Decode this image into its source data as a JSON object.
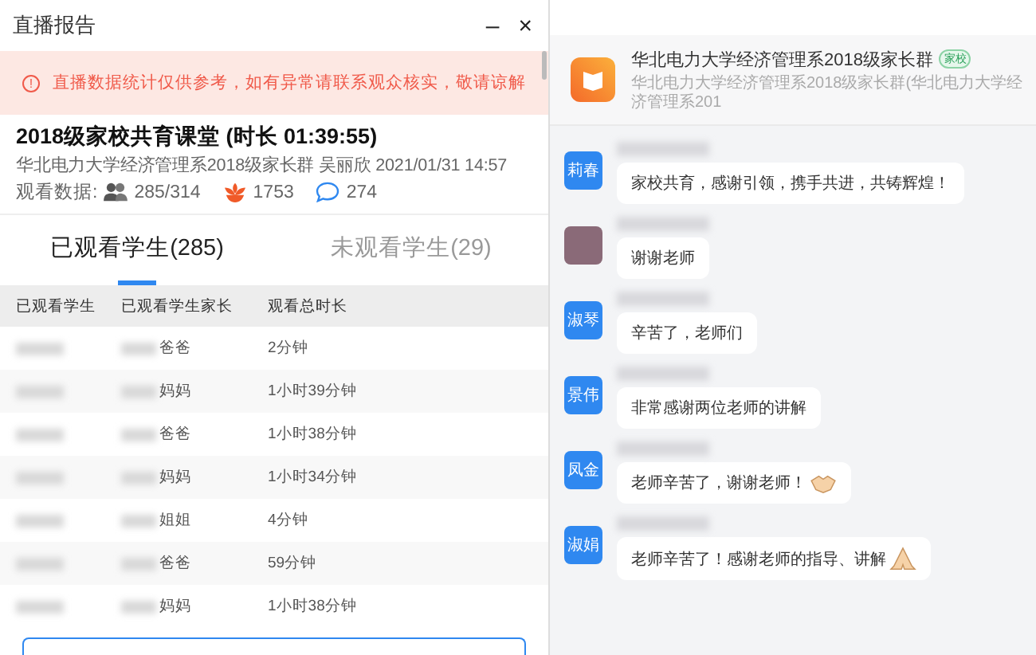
{
  "window": {
    "title": "直播报告",
    "controls": [
      "–",
      "×"
    ]
  },
  "notice": {
    "icon": "!",
    "text": "直播数据统计仅供参考，如有异常请联系观众核实，敬请谅解"
  },
  "report": {
    "title": "2018级家校共育课堂 (时长 01:39:55)",
    "meta": "华北电力大学经济管理系2018级家长群 吴丽欣 2021/01/31 14:57",
    "stats_label": "观看数据:",
    "viewers": "285/314",
    "likes": "1753",
    "comments": "274"
  },
  "tabs": [
    {
      "label": "已观看学生(285)",
      "selected": true
    },
    {
      "label": "未观看学生(29)",
      "selected": false
    }
  ],
  "table": {
    "columns": [
      "已观看学生",
      "已观看学生家长",
      "观看总时长"
    ],
    "rows": [
      {
        "parent": "爸爸",
        "duration": "2分钟"
      },
      {
        "parent": "妈妈",
        "duration": "1小时39分钟"
      },
      {
        "parent": "爸爸",
        "duration": "1小时38分钟"
      },
      {
        "parent": "妈妈",
        "duration": "1小时34分钟"
      },
      {
        "parent": "姐姐",
        "duration": "4分钟"
      },
      {
        "parent": "爸爸",
        "duration": "59分钟"
      },
      {
        "parent": "妈妈",
        "duration": "1小时38分钟"
      }
    ]
  },
  "group": {
    "name": "华北电力大学经济管理系2018级家长群",
    "tag": "家校",
    "subtitle": "华北电力大学经济管理系2018级家长群(华北电力大学经济管理系201"
  },
  "messages": [
    {
      "kind": "text",
      "avatar": {
        "kind": "initials",
        "text": "莉春"
      },
      "text": "家校共育，感谢引领，携手共进，共铸辉煌！"
    },
    {
      "kind": "text",
      "avatar": {
        "kind": "photo"
      },
      "text": "谢谢老师"
    },
    {
      "kind": "text",
      "avatar": {
        "kind": "initials",
        "text": "淑琴"
      },
      "text": "辛苦了，老师们"
    },
    {
      "kind": "text",
      "avatar": {
        "kind": "initials",
        "text": "景伟"
      },
      "text": "非常感谢两位老师的讲解"
    },
    {
      "kind": "handshake",
      "avatar": {
        "kind": "initials",
        "text": "凤金"
      },
      "text": "老师辛苦了，谢谢老师！"
    },
    {
      "kind": "praying",
      "avatar": {
        "kind": "initials",
        "text": "淑娟"
      },
      "text": "老师辛苦了！感谢老师的指导、讲解"
    }
  ]
}
